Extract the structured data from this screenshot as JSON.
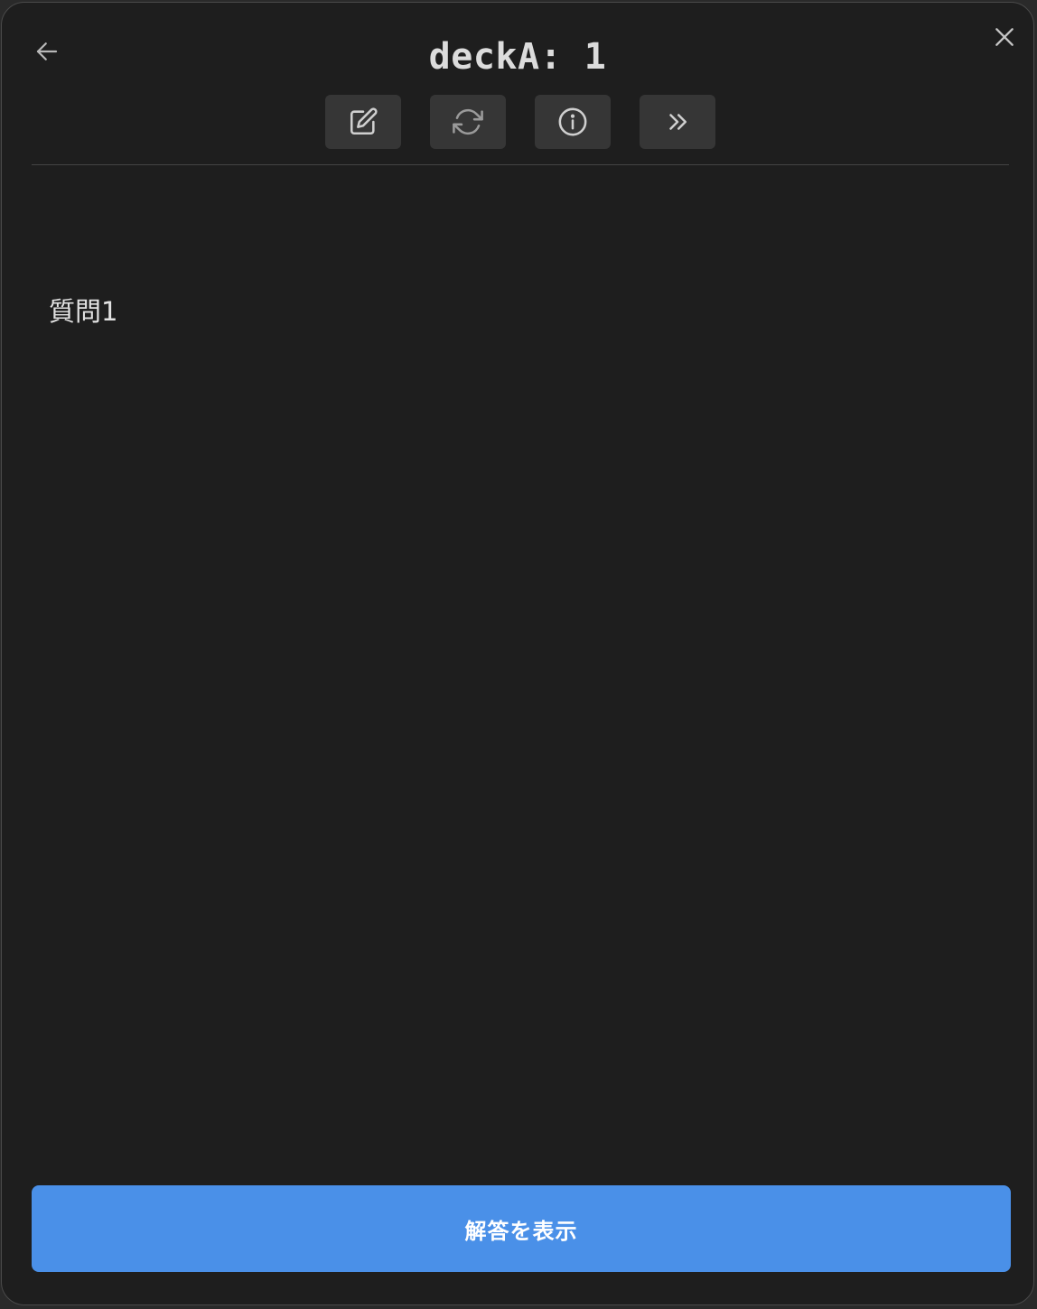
{
  "header": {
    "title": "deckA: 1",
    "back_icon": "arrow-left-icon",
    "close_icon": "close-icon"
  },
  "toolbar": {
    "buttons": [
      {
        "icon": "edit-icon"
      },
      {
        "icon": "refresh-icon"
      },
      {
        "icon": "info-icon"
      },
      {
        "icon": "skip-forward-icon"
      }
    ]
  },
  "card": {
    "question": "質問1"
  },
  "footer": {
    "show_answer_label": "解答を表示"
  },
  "colors": {
    "background": "#1e1e1e",
    "accent": "#4a90e8",
    "button_bg": "#363636",
    "text": "#e2e2e2"
  }
}
